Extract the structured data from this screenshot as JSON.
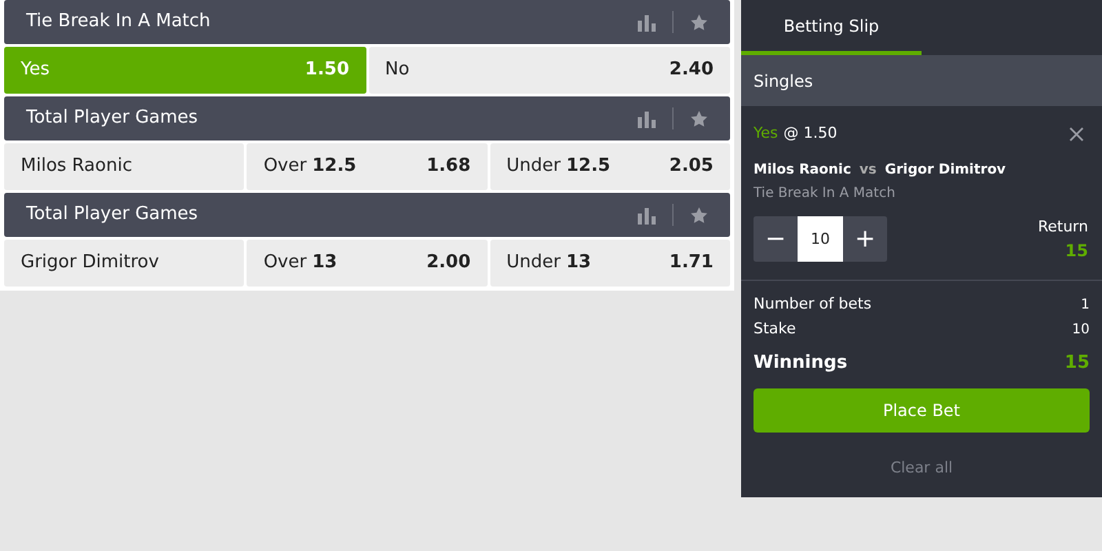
{
  "markets": [
    {
      "title": "Tie Break In A Match",
      "outcomes": [
        {
          "label": "Yes",
          "odds": "1.50",
          "selected": true
        },
        {
          "label": "No",
          "odds": "2.40",
          "selected": false
        }
      ]
    },
    {
      "title": "Total Player Games",
      "player": "Milos Raonic",
      "outcomes": [
        {
          "label": "Over",
          "line": "12.5",
          "odds": "1.68",
          "selected": false
        },
        {
          "label": "Under",
          "line": "12.5",
          "odds": "2.05",
          "selected": false
        }
      ]
    },
    {
      "title": "Total Player Games",
      "player": "Grigor Dimitrov",
      "outcomes": [
        {
          "label": "Over",
          "line": "13",
          "odds": "2.00",
          "selected": false
        },
        {
          "label": "Under",
          "line": "13",
          "odds": "1.71",
          "selected": false
        }
      ]
    }
  ],
  "slip": {
    "tabs": [
      {
        "label": "Betting Slip",
        "selected": true
      }
    ],
    "section": "Singles",
    "bet": {
      "selection": "Yes",
      "odds": "@ 1.50",
      "home": "Milos Raonic",
      "vs": "vs",
      "away": "Grigor Dimitrov",
      "market": "Tie Break In A Match",
      "minus": "−",
      "stake": "10",
      "plus": "+",
      "return_label": "Return",
      "return_value": "15"
    },
    "summary": [
      {
        "kind": "plain",
        "label": "Number of bets",
        "value": "1"
      },
      {
        "kind": "plain",
        "label": "Stake",
        "value": "10"
      },
      {
        "kind": "total",
        "label": "Winnings",
        "value": "15"
      }
    ],
    "button": "Place Bet",
    "clear": "Clear all"
  }
}
